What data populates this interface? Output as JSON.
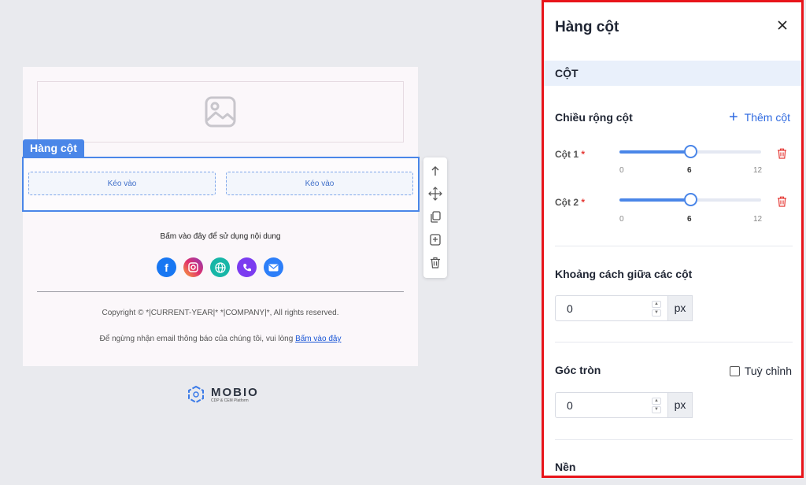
{
  "canvas": {
    "row_tag": "Hàng cột",
    "drop_zones": [
      "Kéo vào",
      "Kéo vào"
    ],
    "cta_text": "Bấm vào đây để sử dụng nội dung",
    "socials": [
      "facebook-icon",
      "instagram-icon",
      "globe-icon",
      "phone-icon",
      "mail-icon"
    ],
    "copyright": "Copyright © *|CURRENT-YEAR|* *|COMPANY|*, All rights reserved.",
    "unsubscribe_text": "Để ngừng nhận email thông báo của chúng tôi, vui lòng ",
    "unsubscribe_link": "Bấm vào đây",
    "logo_name": "MOBIO",
    "logo_tagline": "CDP & CEM Platform"
  },
  "toolbar": {
    "icons": [
      "arrow-up-icon",
      "move-icon",
      "copy-icon",
      "bookmark-add-icon",
      "trash-icon"
    ]
  },
  "panel": {
    "title": "Hàng cột",
    "section": "CỘT",
    "column_width_label": "Chiều rộng cột",
    "add_column": "Thêm cột",
    "columns": [
      {
        "label": "Cột 1",
        "required": "*",
        "value": 6,
        "min": "0",
        "max": "12"
      },
      {
        "label": "Cột 2",
        "required": "*",
        "value": 6,
        "min": "0",
        "max": "12"
      }
    ],
    "gap_label": "Khoảng cách giữa các cột",
    "gap_value": "0",
    "gap_unit": "px",
    "radius_label": "Góc tròn",
    "custom_label": "Tuỳ chỉnh",
    "radius_value": "0",
    "radius_unit": "px",
    "background_label": "Nền"
  },
  "colors": {
    "accent": "#4a86e8",
    "highlight_border": "#e8141a",
    "delete": "#e53935",
    "link": "#2f6ae0"
  }
}
